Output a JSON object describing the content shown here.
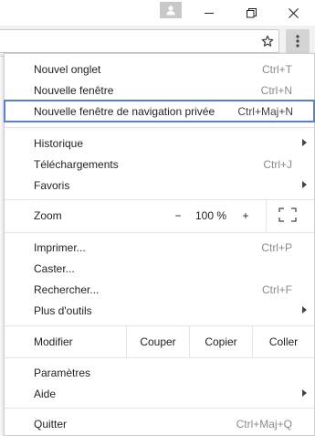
{
  "menu": {
    "new_tab": {
      "label": "Nouvel onglet",
      "shortcut": "Ctrl+T"
    },
    "new_window": {
      "label": "Nouvelle fenêtre",
      "shortcut": "Ctrl+N"
    },
    "new_incognito": {
      "label": "Nouvelle fenêtre de navigation privée",
      "shortcut": "Ctrl+Maj+N"
    },
    "history": {
      "label": "Historique"
    },
    "downloads": {
      "label": "Téléchargements",
      "shortcut": "Ctrl+J"
    },
    "bookmarks": {
      "label": "Favoris"
    },
    "zoom": {
      "label": "Zoom",
      "minus": "−",
      "value": "100 %",
      "plus": "+"
    },
    "print": {
      "label": "Imprimer...",
      "shortcut": "Ctrl+P"
    },
    "cast": {
      "label": "Caster..."
    },
    "find": {
      "label": "Rechercher...",
      "shortcut": "Ctrl+F"
    },
    "more_tools": {
      "label": "Plus d'outils"
    },
    "edit": {
      "label": "Modifier",
      "cut": "Couper",
      "copy": "Copier",
      "paste": "Coller"
    },
    "settings": {
      "label": "Paramètres"
    },
    "help": {
      "label": "Aide"
    },
    "quit": {
      "label": "Quitter",
      "shortcut": "Ctrl+Maj+Q"
    }
  },
  "icons": {
    "profile": "person-icon",
    "minimize": "minimize-icon",
    "restore": "restore-icon",
    "close": "close-icon",
    "bookmark": "star-icon",
    "menu": "three-dots-vertical-icon",
    "fullscreen": "fullscreen-icon",
    "submenu": "chevron-right-icon"
  },
  "colors": {
    "highlight_border": "#5a7fcc",
    "shortcut_text": "#8a8a8a",
    "menu_button_active": "#d4d4d4"
  }
}
